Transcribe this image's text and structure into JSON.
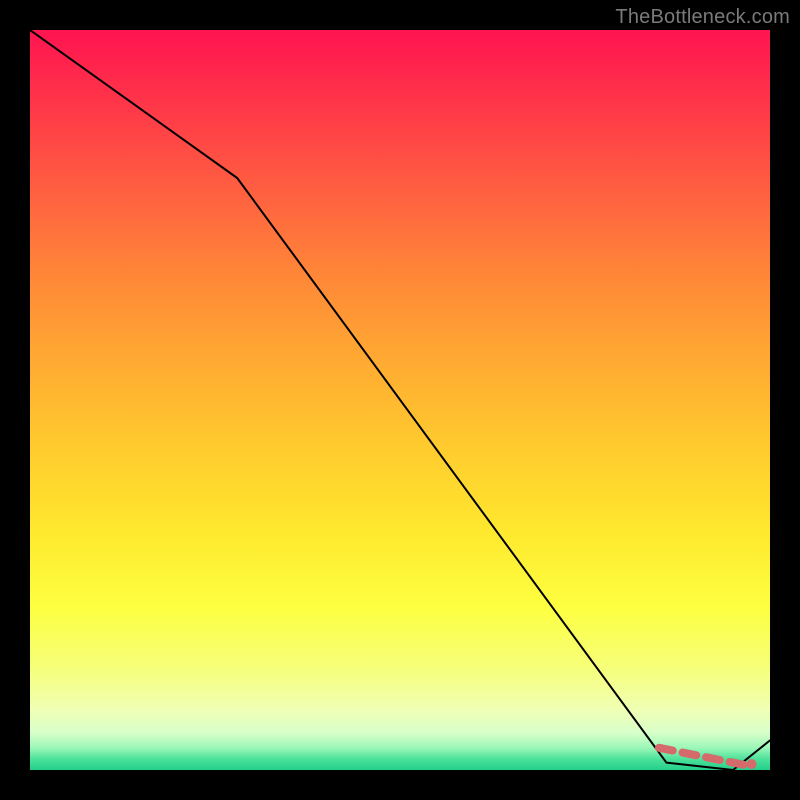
{
  "watermark": "TheBottleneck.com",
  "chart_data": {
    "type": "line",
    "title": "",
    "xlabel": "",
    "ylabel": "",
    "xlim": [
      0,
      100
    ],
    "ylim": [
      0,
      100
    ],
    "curve_main": [
      {
        "x": 0,
        "y": 100
      },
      {
        "x": 28,
        "y": 80
      },
      {
        "x": 86,
        "y": 1
      },
      {
        "x": 95,
        "y": 0
      },
      {
        "x": 100,
        "y": 4
      }
    ],
    "dash_segment": {
      "start": {
        "x": 85,
        "y": 3
      },
      "end": {
        "x": 97,
        "y": 0.6
      }
    },
    "marker": {
      "x": 97.5,
      "y": 0.8
    },
    "colors": {
      "main_line": "#000000",
      "dash_line": "#d46a6a",
      "marker_fill": "#d46a6a",
      "gradient_top": "#ff1450",
      "gradient_mid": "#ffe92e",
      "gradient_bottom": "#22d08b"
    }
  }
}
